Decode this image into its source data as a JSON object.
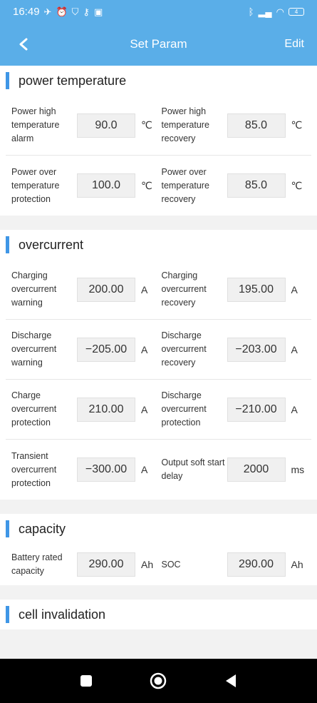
{
  "status_bar": {
    "time": "16:49",
    "left_icons": [
      "app-notification-icon",
      "alarm-icon",
      "shield-icon",
      "key-icon",
      "lock-icon"
    ],
    "right_icons": [
      "bluetooth-icon",
      "signal-icon",
      "wifi-icon"
    ],
    "battery_level": "4"
  },
  "header": {
    "title": "Set Param",
    "edit_label": "Edit",
    "accent": "#5aaee8"
  },
  "sections": [
    {
      "title": "power temperature",
      "rows": [
        [
          {
            "label": "Power high temperature alarm",
            "value": "90.0",
            "unit": "℃"
          },
          {
            "label": "Power high temperature recovery",
            "value": "85.0",
            "unit": "℃"
          }
        ],
        [
          {
            "label": "Power over temperature protection",
            "value": "100.0",
            "unit": "℃"
          },
          {
            "label": "Power over temperature recovery",
            "value": "85.0",
            "unit": "℃"
          }
        ]
      ]
    },
    {
      "title": "overcurrent",
      "rows": [
        [
          {
            "label": "Charging overcurrent warning",
            "value": "200.00",
            "unit": "A"
          },
          {
            "label": "Charging overcurrent recovery",
            "value": "195.00",
            "unit": "A"
          }
        ],
        [
          {
            "label": "Discharge overcurrent warning",
            "value": "−205.00",
            "unit": "A"
          },
          {
            "label": "Discharge overcurrent recovery",
            "value": "−203.00",
            "unit": "A"
          }
        ],
        [
          {
            "label": "Charge overcurrent protection",
            "value": "210.00",
            "unit": "A"
          },
          {
            "label": "Discharge overcurrent protection",
            "value": "−210.00",
            "unit": "A"
          }
        ],
        [
          {
            "label": "Transient overcurrent protection",
            "value": "−300.00",
            "unit": "A"
          },
          {
            "label": "Output soft start delay",
            "value": "2000",
            "unit": "ms"
          }
        ]
      ]
    },
    {
      "title": "capacity",
      "rows": [
        [
          {
            "label": "Battery rated capacity",
            "value": "290.00",
            "unit": "Ah"
          },
          {
            "label": "SOC",
            "value": "290.00",
            "unit": "Ah"
          }
        ]
      ]
    },
    {
      "title": "cell invalidation",
      "rows": []
    }
  ],
  "nav_bar": {
    "buttons": [
      "recents-square-icon",
      "home-circle-icon",
      "back-triangle-icon"
    ]
  }
}
